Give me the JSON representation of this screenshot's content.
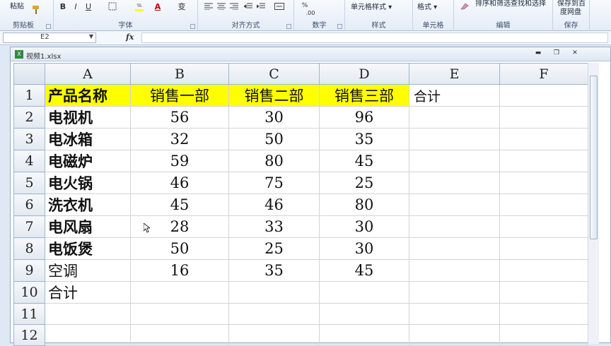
{
  "ribbon": {
    "clipboard": {
      "paste_label": "粘贴",
      "caption": "剪贴板"
    },
    "font": {
      "bold": "B",
      "italic": "I",
      "underline": "U",
      "font_color": "A",
      "phonetic": "变",
      "caption": "字体"
    },
    "alignment": {
      "caption": "对齐方式"
    },
    "number": {
      "caption": "数字",
      "percent": "%",
      "decimals": ".00"
    },
    "styles": {
      "cell_styles": "单元格样式",
      "caption": "样式"
    },
    "cells": {
      "format": "格式",
      "caption": "单元格"
    },
    "editing": {
      "sort_filter": "排序和筛选",
      "find_select": "查找和选择",
      "caption": "编辑"
    },
    "save": {
      "save_to": "保存到百",
      "cloud": "度网盘",
      "caption": "保存"
    }
  },
  "formula_bar": {
    "name_box": "E2",
    "fx": "fx",
    "formula": ""
  },
  "workbook": {
    "filename": "视频1.xlsx"
  },
  "sheet": {
    "columns": [
      "A",
      "B",
      "C",
      "D",
      "E",
      "F"
    ],
    "row_numbers": [
      "1",
      "2",
      "3",
      "4",
      "5",
      "6",
      "7",
      "8",
      "9",
      "10",
      "11",
      "12"
    ],
    "header": [
      "产品名称",
      "销售一部",
      "销售二部",
      "销售三部",
      "合计"
    ],
    "rows": [
      [
        "电视机",
        "56",
        "30",
        "96"
      ],
      [
        "电冰箱",
        "32",
        "50",
        "35"
      ],
      [
        "电磁炉",
        "59",
        "80",
        "45"
      ],
      [
        "电火锅",
        "46",
        "75",
        "25"
      ],
      [
        "洗衣机",
        "45",
        "46",
        "80"
      ],
      [
        "电风扇",
        "28",
        "33",
        "30"
      ],
      [
        "电饭煲",
        "50",
        "25",
        "30"
      ],
      [
        "空调",
        "16",
        "35",
        "45"
      ]
    ],
    "total_label": "合计",
    "header_fill": "#ffff00"
  }
}
